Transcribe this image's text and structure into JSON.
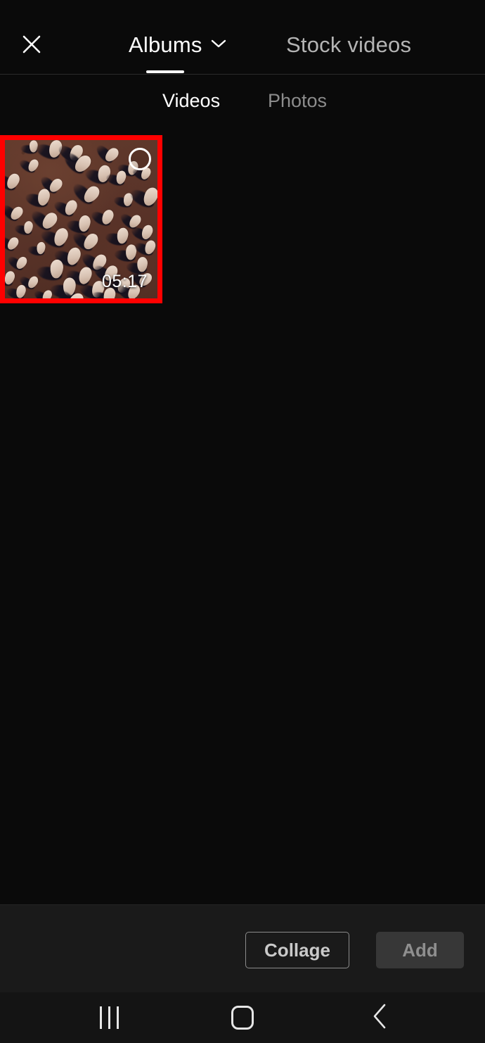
{
  "header": {
    "close_icon": "close-x-icon",
    "tabs": [
      {
        "label": "Albums",
        "active": true,
        "has_dropdown": true,
        "dropdown_icon": "chevron-down-icon"
      },
      {
        "label": "Stock videos",
        "active": false,
        "has_dropdown": false
      }
    ]
  },
  "subtabs": [
    {
      "label": "Videos",
      "active": true
    },
    {
      "label": "Photos",
      "active": false
    }
  ],
  "media_grid": {
    "items": [
      {
        "type": "video",
        "duration": "05:17",
        "selected": true,
        "checkbox_icon": "circle-checkbox-icon",
        "description": "aerial drone view of a herd of sheep on red-brown ground with long shadows"
      }
    ]
  },
  "toolbar": {
    "collage_label": "Collage",
    "add_label": "Add"
  },
  "navbar": {
    "recents_icon": "recents-bars-icon",
    "home_icon": "home-square-icon",
    "back_icon": "back-chevron-icon"
  },
  "colors": {
    "background": "#0a0a0a",
    "toolbar_background": "#1a1a1a",
    "navbar_background": "#141414",
    "selection_border": "#ff0000",
    "active_text": "#ffffff",
    "inactive_text": "#8c8c8c",
    "stock_tab_text": "#b4b4b4",
    "add_button_fill": "#373737",
    "collage_button_border": "#8c8c8c"
  }
}
